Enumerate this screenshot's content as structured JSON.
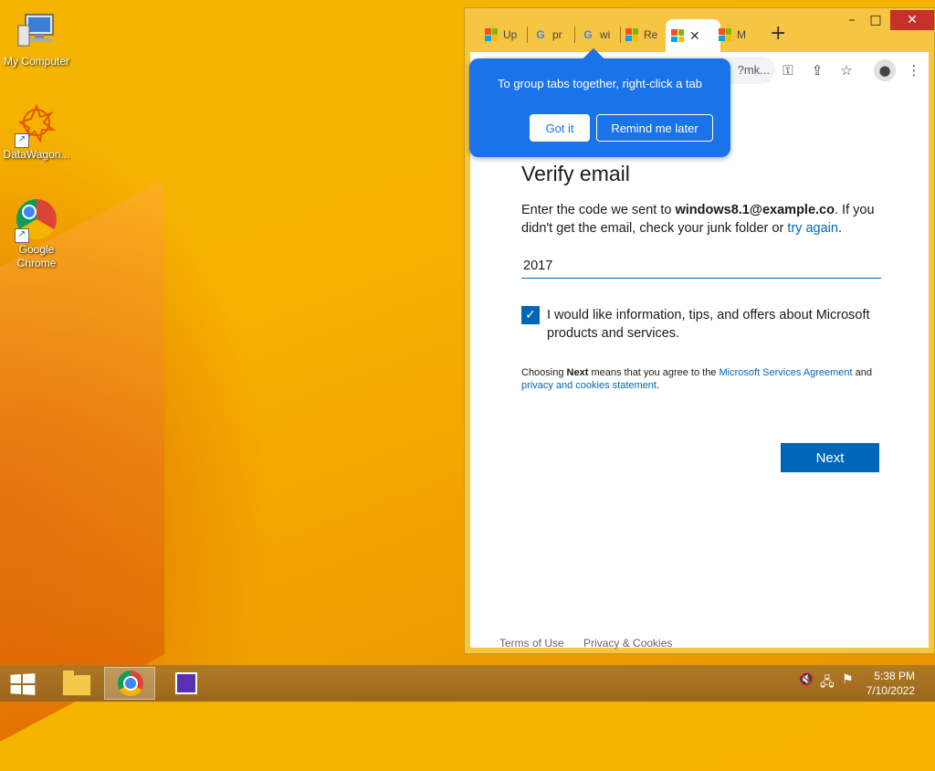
{
  "desktop": {
    "icons": [
      {
        "label": "My Computer"
      },
      {
        "label": "DataWagon..."
      },
      {
        "label": "Google Chrome"
      }
    ]
  },
  "browser": {
    "tabs": [
      {
        "title": "Up",
        "icon": "microsoft-logo"
      },
      {
        "title": "pr",
        "icon": "google-logo"
      },
      {
        "title": "wi",
        "icon": "google-logo"
      },
      {
        "title": "Re",
        "icon": "microsoft-logo"
      },
      {
        "title": "",
        "icon": "microsoft-logo",
        "active": true
      },
      {
        "title": "M",
        "icon": "microsoft-logo"
      }
    ],
    "new_tab": "+",
    "address_fragment": "?mk...",
    "window_controls": {
      "minimize": "–",
      "maximize": "□",
      "close": "✕"
    }
  },
  "bubble": {
    "text": "To group tabs together, right-click a tab",
    "got_it": "Got it",
    "remind_later": "Remind me later"
  },
  "page": {
    "title": "Verify email",
    "desc_prefix": "Enter the code we sent to ",
    "email": "windows8.1@example.co",
    "desc_mid": ". If you didn't get the email, check your junk folder or ",
    "try_again": "try again",
    "desc_end": ".",
    "code_value": "2017",
    "checkbox_checked": true,
    "checkbox_label": "I would like information, tips, and offers about Microsoft products and services.",
    "legal_prefix": "Choosing ",
    "legal_next": "Next",
    "legal_mid": " means that you agree to the ",
    "legal_link1": "Microsoft Services Agreement",
    "legal_and": " and ",
    "legal_link2": "privacy and cookies statement",
    "legal_end": ".",
    "next_button": "Next",
    "footer": {
      "terms": "Terms of Use",
      "privacy": "Privacy & Cookies"
    }
  },
  "taskbar": {
    "time": "5:38 PM",
    "date": "7/10/2022"
  },
  "colors": {
    "ms_blue": "#0067b8",
    "chrome_bubble": "#1a73e8",
    "desktop_yellow": "#f4b400"
  }
}
